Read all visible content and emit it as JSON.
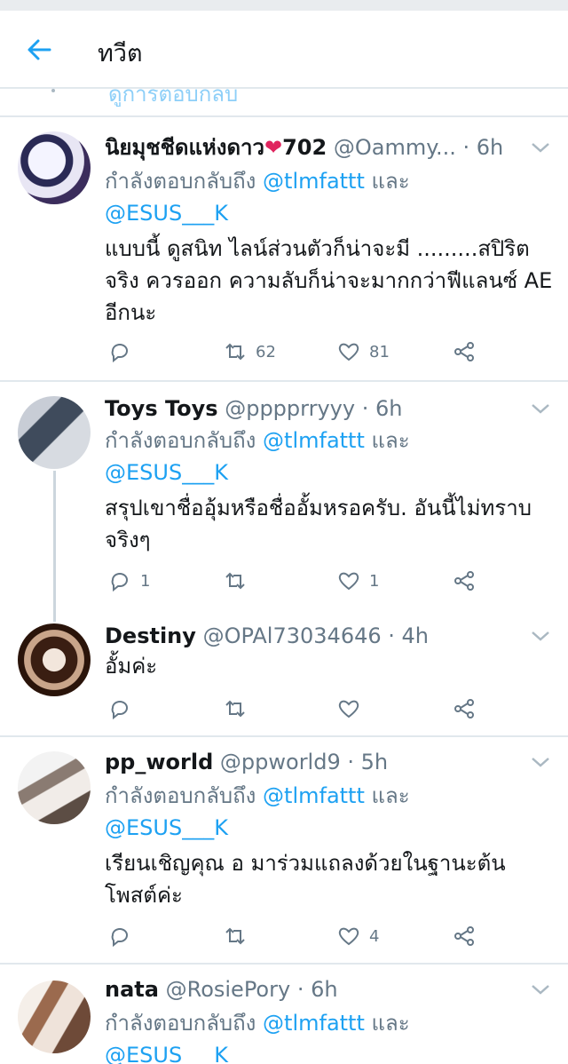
{
  "header": {
    "title": "ทวีต"
  },
  "partial_above": {
    "text": "ดูการตอบกลับ"
  },
  "reply_prefix": "กำลังตอบกลับถึง",
  "reply_and": "และ",
  "colors": {
    "accent": "#1da1f2",
    "secondary": "#657786",
    "text": "#14171a",
    "divider": "#e1e8ed",
    "heart": "#e0245e"
  },
  "tweets": [
    {
      "name": "นิยมุชชีดแห่งดาว",
      "name_emoji": "❤",
      "name_suffix": "702",
      "handle": "@Oammy...",
      "time": "· 6h",
      "mention1": "@tlmfattt",
      "mention2": "@ESUS___K",
      "text": "แบบนี้ ดูสนิท ไลน์ส่วนตัวก็น่าจะมี .........สปิริตจริง ควรออก ความลับก็น่าจะมากกว่าฟีแลนซ์ AE อีกนะ",
      "retweets": "62",
      "likes": "81",
      "replies": ""
    },
    {
      "name": "Toys Toys",
      "handle": "@pppprryyy",
      "time": "· 6h",
      "mention1": "@tlmfattt",
      "mention2": "@ESUS___K",
      "text": "สรุปเขาชื่ออุ้มหรือชื่ออั้มหรอครับ. อันนี้ไม่ทราบจริงๆ",
      "replies": "1",
      "retweets": "",
      "likes": "1"
    },
    {
      "name": "Destiny",
      "handle": "@OPAl73034646",
      "time": "· 4h",
      "text": "อั้มค่ะ",
      "replies": "",
      "retweets": "",
      "likes": ""
    },
    {
      "name": "pp_world",
      "handle": "@ppworld9",
      "time": "· 5h",
      "mention1": "@tlmfattt",
      "mention2": "@ESUS___K",
      "text": "เรียนเชิญคุณ อ มาร่วมแถลงด้วยในฐานะต้นโพสต์ค่ะ",
      "replies": "",
      "retweets": "",
      "likes": "4"
    },
    {
      "name": "nata",
      "handle": "@RosiePory",
      "time": "· 6h",
      "mention1": "@tlmfattt",
      "mention2": "@ESUS___K"
    }
  ]
}
